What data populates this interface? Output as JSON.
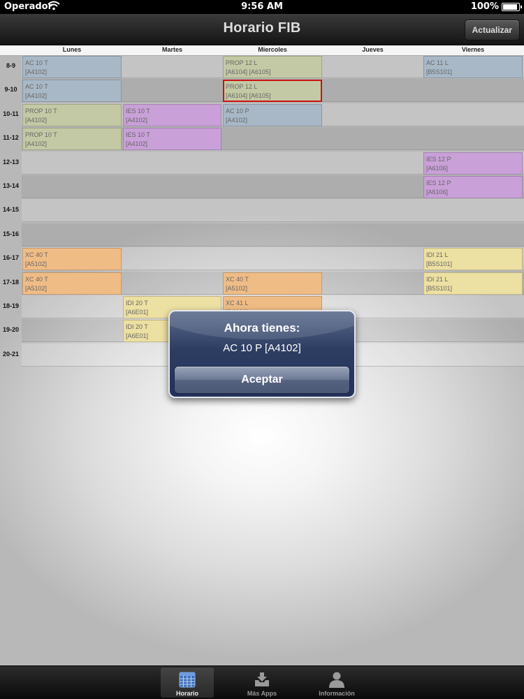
{
  "status_bar": {
    "carrier": "Operador",
    "time": "9:56 AM",
    "battery": "100%",
    "battery_level": 1.0,
    "wifi_icon": "wifi-icon"
  },
  "nav": {
    "title": "Horario FIB",
    "update_label": "Actualizar"
  },
  "days": [
    "Lunes",
    "Martes",
    "Miercoles",
    "Jueves",
    "Viernes"
  ],
  "hours": [
    "8-9",
    "9-10",
    "10-11",
    "11-12",
    "12-13",
    "13-14",
    "14-15",
    "15-16",
    "16-17",
    "17-18",
    "18-19",
    "19-20",
    "20-21"
  ],
  "colors": {
    "AC": "#a8b8c6",
    "PROP": "#c3c9a4",
    "IES": "#c9a0d8",
    "XC": "#f0bc86",
    "IDI": "#ece0a2",
    "selected_border": "#cc1111"
  },
  "classes": [
    {
      "day": 0,
      "hour": 0,
      "line1": "AC 10 T",
      "line2": "[A4102]",
      "type": "AC"
    },
    {
      "day": 0,
      "hour": 1,
      "line1": "AC 10 T",
      "line2": "[A4102]",
      "type": "AC"
    },
    {
      "day": 0,
      "hour": 2,
      "line1": "PROP 10 T",
      "line2": "[A4102]",
      "type": "PROP"
    },
    {
      "day": 0,
      "hour": 3,
      "line1": "PROP 10 T",
      "line2": "[A4102]",
      "type": "PROP"
    },
    {
      "day": 0,
      "hour": 8,
      "line1": "XC 40 T",
      "line2": "[A5102]",
      "type": "XC"
    },
    {
      "day": 0,
      "hour": 9,
      "line1": "XC 40 T",
      "line2": "[A5102]",
      "type": "XC"
    },
    {
      "day": 1,
      "hour": 2,
      "line1": "IES 10 T",
      "line2": "[A4102]",
      "type": "IES"
    },
    {
      "day": 1,
      "hour": 3,
      "line1": "IES 10 T",
      "line2": "[A4102]",
      "type": "IES"
    },
    {
      "day": 1,
      "hour": 10,
      "line1": "IDI 20 T",
      "line2": "[A6E01]",
      "type": "IDI"
    },
    {
      "day": 1,
      "hour": 11,
      "line1": "IDI 20 T",
      "line2": "[A6E01]",
      "type": "IDI"
    },
    {
      "day": 2,
      "hour": 0,
      "line1": "PROP 12 L",
      "line2": "[A6104] [A6105]",
      "type": "PROP"
    },
    {
      "day": 2,
      "hour": 1,
      "line1": "PROP 12 L",
      "line2": "[A6104] [A6105]",
      "type": "PROP",
      "selected": true
    },
    {
      "day": 2,
      "hour": 2,
      "line1": "AC 10 P",
      "line2": "[A4102]",
      "type": "AC"
    },
    {
      "day": 2,
      "hour": 9,
      "line1": "XC 40 T",
      "line2": "[A5102]",
      "type": "XC"
    },
    {
      "day": 2,
      "hour": 10,
      "line1": "XC 41 L",
      "line2": "[D6003]",
      "type": "XC"
    },
    {
      "day": 4,
      "hour": 0,
      "line1": "AC 11 L",
      "line2": "[B5S101]",
      "type": "AC"
    },
    {
      "day": 4,
      "hour": 4,
      "line1": "IES 12 P",
      "line2": "[A6106]",
      "type": "IES"
    },
    {
      "day": 4,
      "hour": 5,
      "line1": "IES 12 P",
      "line2": "[A6106]",
      "type": "IES"
    },
    {
      "day": 4,
      "hour": 8,
      "line1": "IDI 21 L",
      "line2": "[B5S101]",
      "type": "IDI"
    },
    {
      "day": 4,
      "hour": 9,
      "line1": "IDI 21 L",
      "line2": "[B5S101]",
      "type": "IDI"
    }
  ],
  "alert": {
    "title": "Ahora tienes:",
    "message": "AC 10 P [A4102]",
    "button": "Aceptar"
  },
  "tabs": [
    {
      "label": "Horario",
      "icon": "calendar-icon",
      "active": true
    },
    {
      "label": "Más Apps",
      "icon": "inbox-download-icon",
      "active": false
    },
    {
      "label": "Información",
      "icon": "person-icon",
      "active": false
    }
  ]
}
